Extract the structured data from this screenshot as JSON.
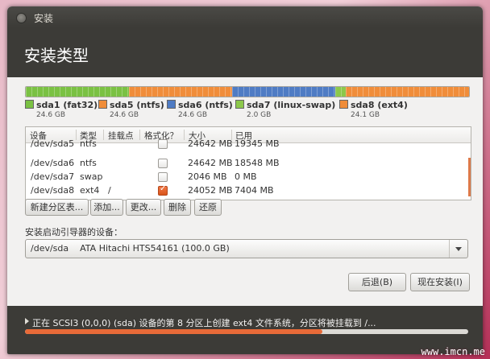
{
  "window": {
    "title": "安装"
  },
  "page": {
    "title": "安装类型"
  },
  "partitions": [
    {
      "name": "sda1 (fat32)",
      "size": "24.6 GB",
      "color": "#7ac143",
      "share": 0.2
    },
    {
      "name": "sda5 (ntfs)",
      "size": "24.6 GB",
      "color": "#f08d3a",
      "share": 0.2
    },
    {
      "name": "sda6 (ntfs)",
      "size": "24.6 GB",
      "color": "#4f7cc4",
      "share": 0.2
    },
    {
      "name": "sda7 (linux-swap)",
      "size": "2.0 GB",
      "color": "#8cc84b",
      "share": 0.02
    },
    {
      "name": "sda8 (ext4)",
      "size": "24.1 GB",
      "color": "#f08d3a",
      "share": 0.24
    }
  ],
  "table": {
    "headers": [
      "设备",
      "类型",
      "挂载点",
      "格式化？",
      "大小",
      "已用"
    ],
    "rows": [
      {
        "device": "/dev/sda5",
        "type": "ntfs",
        "mount": "",
        "format": false,
        "size": "24642 MB",
        "used": "19345 MB"
      },
      {
        "device": "/dev/sda6",
        "type": "ntfs",
        "mount": "",
        "format": false,
        "size": "24642 MB",
        "used": "18548 MB"
      },
      {
        "device": "/dev/sda7",
        "type": "swap",
        "mount": "",
        "format": false,
        "size": "2046 MB",
        "used": "0 MB"
      },
      {
        "device": "/dev/sda8",
        "type": "ext4",
        "mount": "/",
        "format": true,
        "size": "24052 MB",
        "used": "7404 MB"
      }
    ]
  },
  "actions": {
    "new_table": "新建分区表...",
    "add": "添加...",
    "change": "更改...",
    "delete": "删除",
    "revert": "还原"
  },
  "bootloader": {
    "label": "安装启动引导器的设备：",
    "device": "/dev/sda",
    "description": "ATA Hitachi HTS54161 (100.0 GB)"
  },
  "nav": {
    "back": "后退(B)",
    "install": "现在安装(I)"
  },
  "progress": {
    "text": "正在 SCSI3 (0,0,0) (sda) 设备的第 8 分区上创建 ext4 文件系统，分区将被挂载到 /...",
    "value": 0.67
  },
  "watermark": "www.imcn.me"
}
